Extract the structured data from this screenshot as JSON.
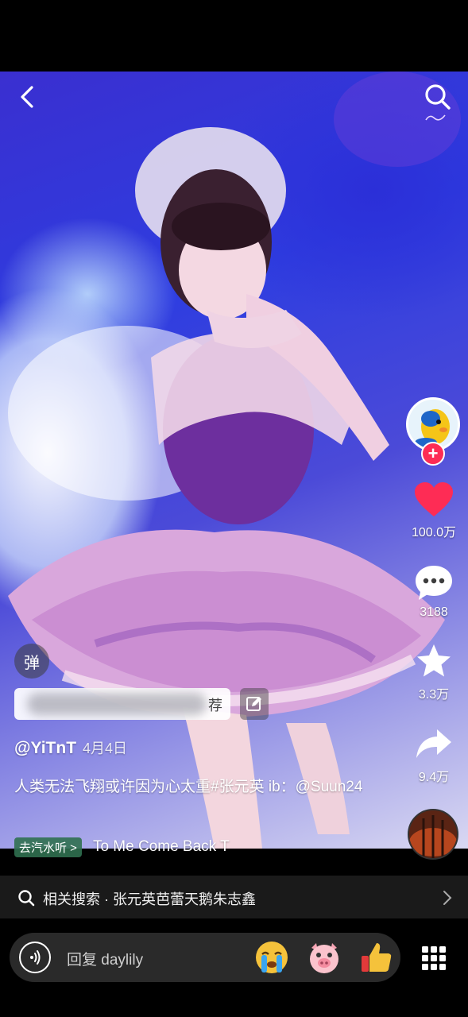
{
  "top": {
    "back_icon": "chevron-left-icon",
    "search_icon": "search-icon"
  },
  "author": {
    "follow_badge": "+"
  },
  "actions": {
    "like": {
      "icon": "heart-icon",
      "count": "100.0万",
      "color": "#fe2c55"
    },
    "comment": {
      "icon": "comment-bubble-icon",
      "count": "3188"
    },
    "favorite": {
      "icon": "star-icon",
      "count": "3.3万"
    },
    "share": {
      "icon": "share-arrow-icon",
      "count": "9.4万"
    }
  },
  "overlay": {
    "danmaku_label": "弹",
    "comment_input_suffix": "荐",
    "edit_icon": "edit-icon"
  },
  "post": {
    "username": "@YiTnT",
    "date": "4月4日",
    "caption": "人类无法飞翔或许因为心太重#张元英 ib：@Suun24"
  },
  "music": {
    "tag_label": "去汽水听 >",
    "title": "To Me   Come Back T"
  },
  "related_search": {
    "text": "相关搜索 · 张元英芭蕾天鹅朱志鑫"
  },
  "reply_bar": {
    "placeholder": "回复 daylily",
    "emojis": [
      "crying-emoji",
      "pig-emoji",
      "thumbs-up-emoji"
    ],
    "grid_icon": "grid-menu-icon"
  }
}
